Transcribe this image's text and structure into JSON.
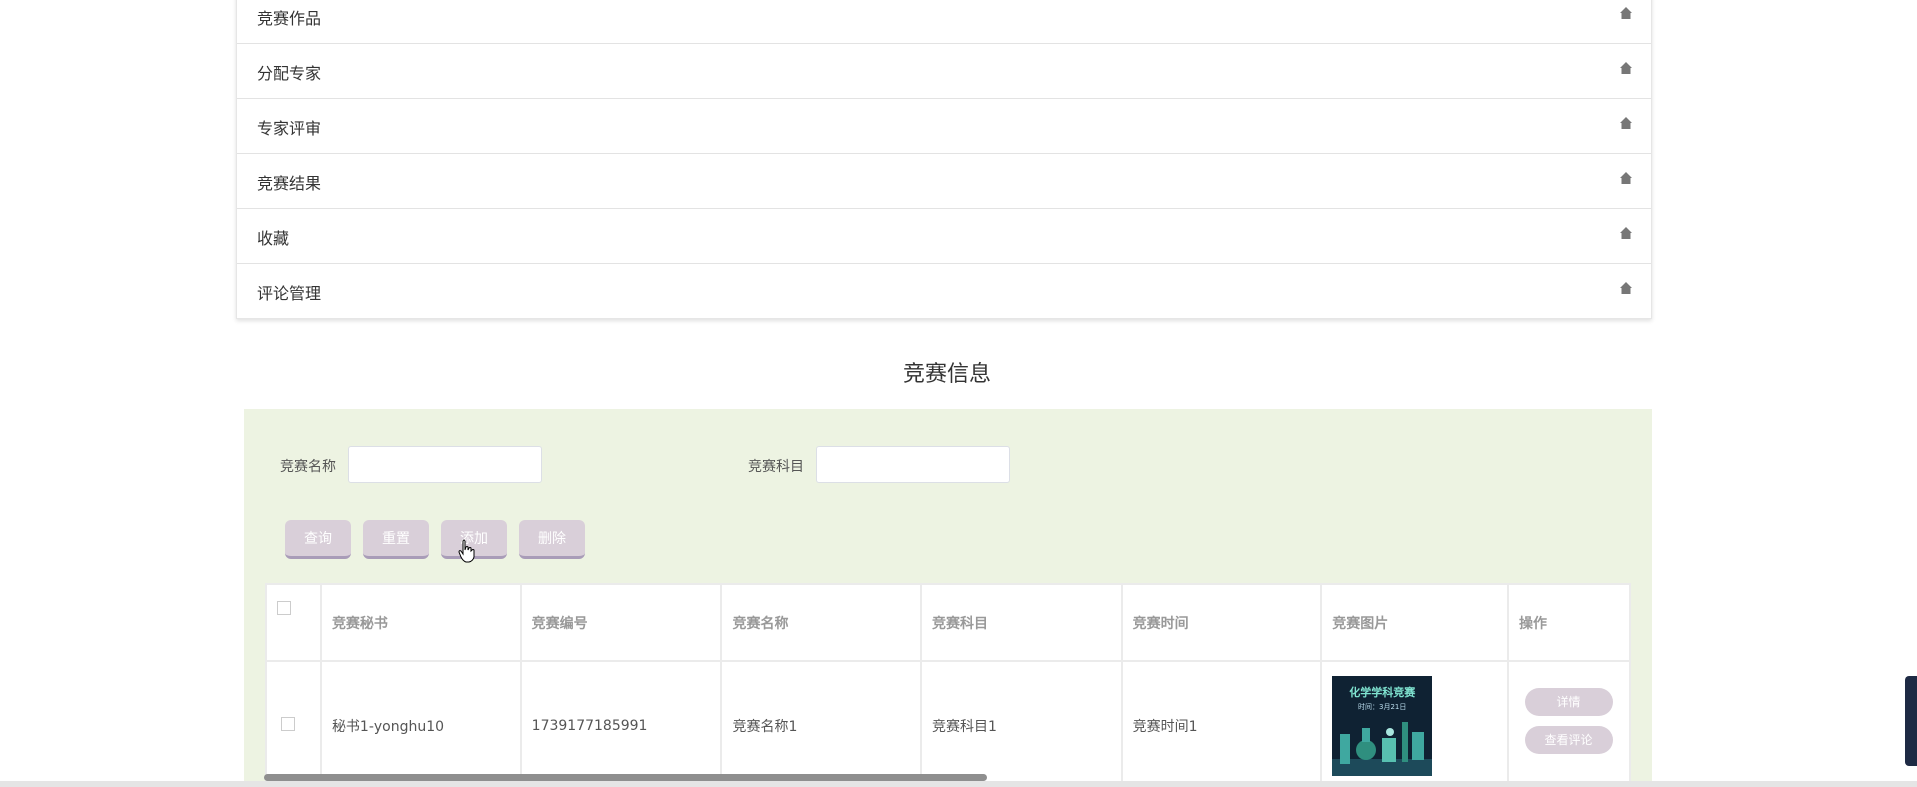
{
  "menu": {
    "items": [
      {
        "label": "竞赛作品"
      },
      {
        "label": "分配专家"
      },
      {
        "label": "专家评审"
      },
      {
        "label": "竞赛结果"
      },
      {
        "label": "收藏"
      },
      {
        "label": "评论管理"
      }
    ]
  },
  "section": {
    "title": "竞赛信息"
  },
  "search": {
    "name_label": "竞赛名称",
    "name_value": "",
    "subject_label": "竞赛科目",
    "subject_value": ""
  },
  "actions": {
    "query": "查询",
    "reset": "重置",
    "add": "添加",
    "delete": "删除"
  },
  "table": {
    "headers": [
      "竞赛秘书",
      "竞赛编号",
      "竞赛名称",
      "竞赛科目",
      "竞赛时间",
      "竞赛图片",
      "操作"
    ],
    "rows": [
      {
        "secretary": "秘书1-yonghu10",
        "number": "1739177185991",
        "name": "竞赛名称1",
        "subject": "竞赛科目1",
        "time": "竞赛时间1",
        "image_title": "化学学科竞赛",
        "image_subtitle": "时间：3月21日",
        "detail_label": "详情",
        "comments_label": "查看评论"
      }
    ]
  },
  "colors": {
    "panel_bg": "#edf3e2",
    "button_bg": "#d9cfd9",
    "button_border": "#a99cb8"
  }
}
